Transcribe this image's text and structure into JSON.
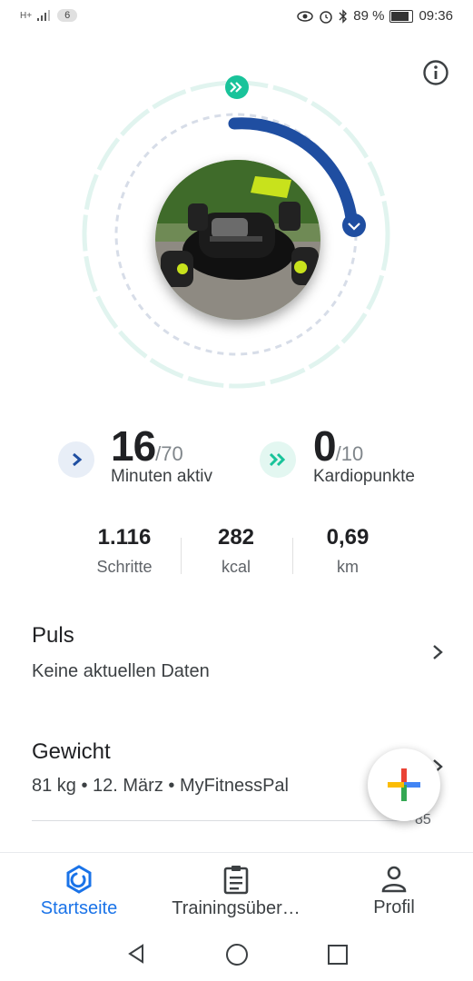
{
  "status_bar": {
    "signal": "H+",
    "notification_count": "6",
    "battery": "89 %",
    "time": "09:36",
    "icons": [
      "eye-icon",
      "alarm-icon",
      "bluetooth-icon",
      "battery-icon"
    ]
  },
  "ring": {
    "move_minutes_progress": 0.23,
    "heart_points_progress": 0.0,
    "colors": {
      "move": "#1a4fa0",
      "heart": "#19c39a",
      "track": "#dde5ef"
    }
  },
  "goals": {
    "move_minutes": {
      "value": "16",
      "goal": "/70",
      "label": "Minuten aktiv"
    },
    "heart_points": {
      "value": "0",
      "goal": "/10",
      "label": "Kardiopunkte"
    }
  },
  "stats": [
    {
      "value": "1.116",
      "unit": "Schritte"
    },
    {
      "value": "282",
      "unit": "kcal"
    },
    {
      "value": "0,69",
      "unit": "km"
    }
  ],
  "cards": {
    "puls": {
      "title": "Puls",
      "subtitle": "Keine aktuellen Daten"
    },
    "gewicht": {
      "title": "Gewicht",
      "subtitle": "81 kg • 12. März • MyFitnessPal",
      "chart_peek": "85"
    }
  },
  "bottom_nav": [
    {
      "label": "Startseite",
      "icon": "home-ring-icon",
      "active": true
    },
    {
      "label": "Trainingsüber…",
      "icon": "clipboard-icon",
      "active": false
    },
    {
      "label": "Profil",
      "icon": "person-icon",
      "active": false
    }
  ]
}
